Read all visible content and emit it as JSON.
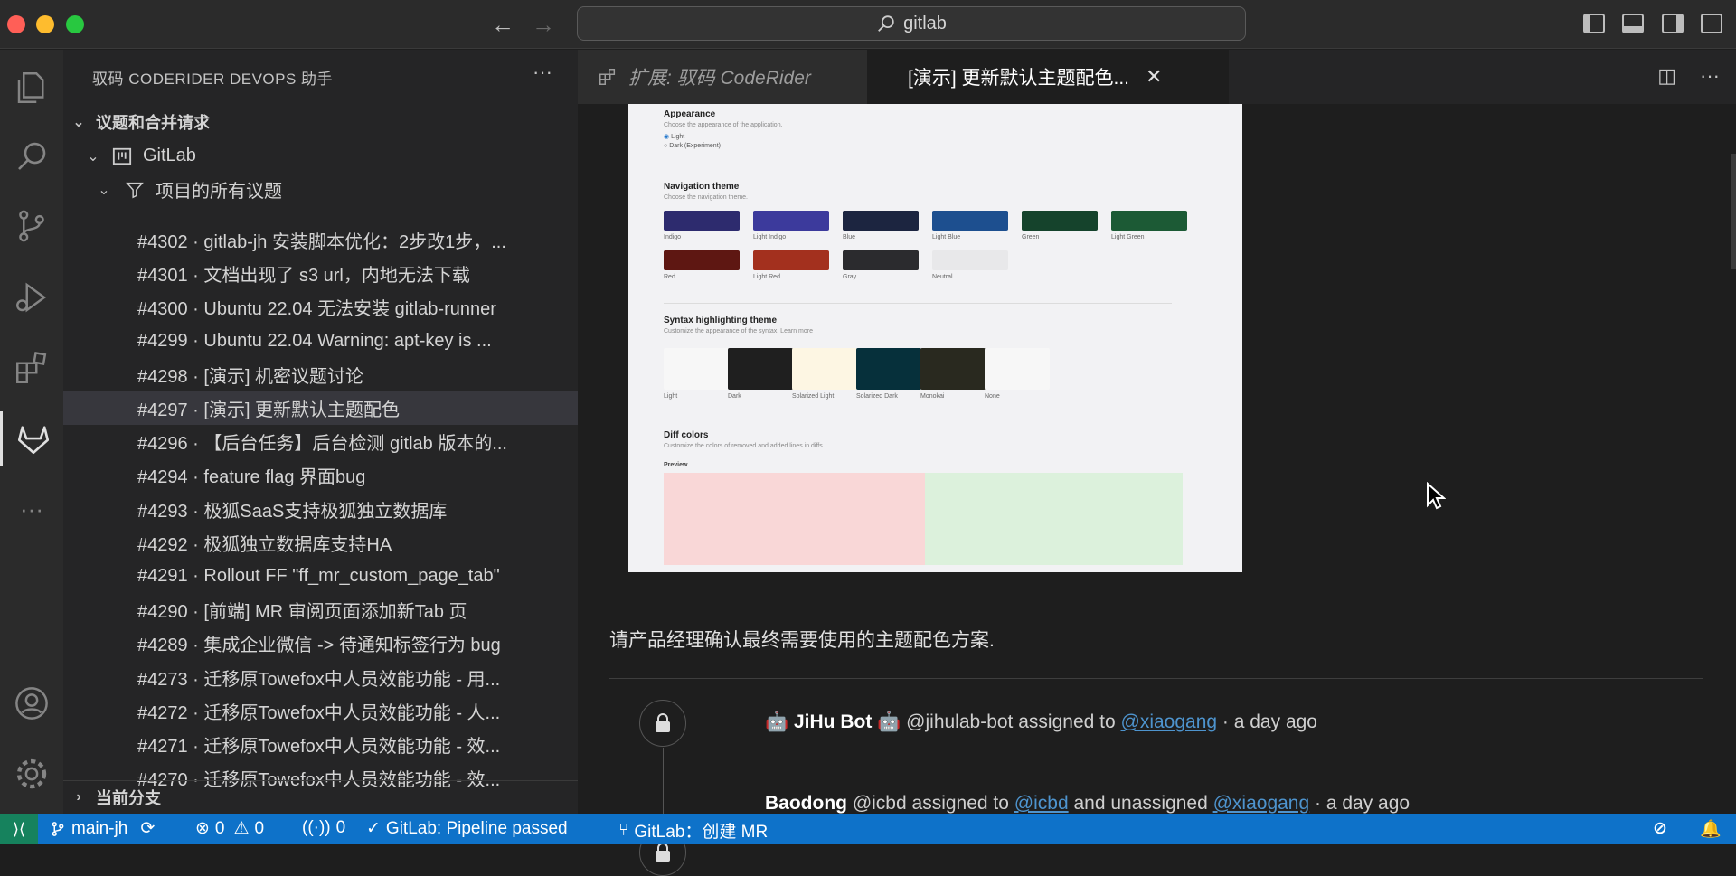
{
  "titlebar": {
    "search": "gitlab"
  },
  "sidebar": {
    "title": "驭码 CODERIDER DEVOPS 助手",
    "section": "议题和合并请求",
    "project": "GitLab",
    "filter": "项目的所有议题",
    "issues": [
      "#4302 · gitlab-jh 安装脚本优化：2步改1步，...",
      "#4301 · 文档出现了 s3 url，内地无法下载",
      "#4300 · Ubuntu 22.04 无法安装 gitlab-runner",
      "#4299 · Ubuntu 22.04 Warning: apt-key is ...",
      "#4298 · [演示] 机密议题讨论",
      "#4297 · [演示] 更新默认主题配色",
      "#4296 · 【后台任务】后台检测 gitlab 版本的...",
      "#4294 · feature flag 界面bug",
      "#4293 · 极狐SaaS支持极狐独立数据库",
      "#4292 · 极狐独立数据库支持HA",
      "#4291 · Rollout FF \"ff_mr_custom_page_tab\"",
      "#4290 · [前端] MR 审阅页面添加新Tab 页",
      "#4289 · 集成企业微信 -> 待通知标签行为 bug",
      "#4273 · 迁移原Towefox中人员效能功能 - 用...",
      "#4272 · 迁移原Towefox中人员效能功能 - 人...",
      "#4271 · 迁移原Towefox中人员效能功能 - 效...",
      "#4270 · 迁移原Towefox中人员效能功能 - 效..."
    ],
    "branch_section": "当前分支"
  },
  "tabs": [
    {
      "label": "扩展: 驭码 CodeRider"
    },
    {
      "label": "[演示] 更新默认主题配色..."
    }
  ],
  "content": {
    "screenshot": {
      "appearance_title": "Appearance",
      "appearance_sub": "Choose the appearance of the application.",
      "appearance_light": "Light",
      "appearance_dark": "Dark (Experiment)",
      "nav_title": "Navigation theme",
      "nav_sub": "Choose the navigation theme.",
      "nav_swatches": [
        {
          "label": "Indigo",
          "color": "#2d2b6e"
        },
        {
          "label": "Light Indigo",
          "color": "#3c3a9c"
        },
        {
          "label": "Blue",
          "color": "#1c2540"
        },
        {
          "label": "Light Blue",
          "color": "#1d4f8f"
        },
        {
          "label": "Green",
          "color": "#15432c"
        },
        {
          "label": "Light Green",
          "color": "#1c5a35"
        },
        {
          "label": "Red",
          "color": "#5e1712"
        },
        {
          "label": "Light Red",
          "color": "#a3301e"
        },
        {
          "label": "Gray",
          "color": "#2b2b2e"
        },
        {
          "label": "Neutral",
          "color": "#e8e8ea"
        }
      ],
      "syntax_title": "Syntax highlighting theme",
      "syntax_sub": "Customize the appearance of the syntax. Learn more",
      "syntax_themes": [
        {
          "label": "Light",
          "color": "#f7f7f7"
        },
        {
          "label": "Dark",
          "color": "#1f1f1f"
        },
        {
          "label": "Solarized Light",
          "color": "#fdf6e3"
        },
        {
          "label": "Solarized Dark",
          "color": "#06303b"
        },
        {
          "label": "Monokai",
          "color": "#29291f"
        },
        {
          "label": "None",
          "color": "#f7f7f7"
        }
      ],
      "diff_title": "Diff colors",
      "diff_sub": "Customize the colors of removed and added lines in diffs.",
      "diff_preview": "Preview"
    },
    "description": "请产品经理确认最终需要使用的主题配色方案.",
    "notes": [
      {
        "author": "JiHu Bot",
        "handle": "@jihulab-bot",
        "text1": "assigned to",
        "link1": "@xiaogang",
        "text2": "",
        "link2": "",
        "time": "· a day ago"
      },
      {
        "author": "Baodong",
        "handle": "@icbd",
        "text1": "assigned to",
        "link1": "@icbd",
        "text2": "and unassigned",
        "link2": "@xiaogang",
        "time": "· a day ago"
      }
    ]
  },
  "statusbar": {
    "branch": "main-jh",
    "errors": "0",
    "warnings": "0",
    "ports": "0",
    "pipeline": "GitLab: Pipeline passed",
    "create_mr": "GitLab：创建 MR"
  }
}
